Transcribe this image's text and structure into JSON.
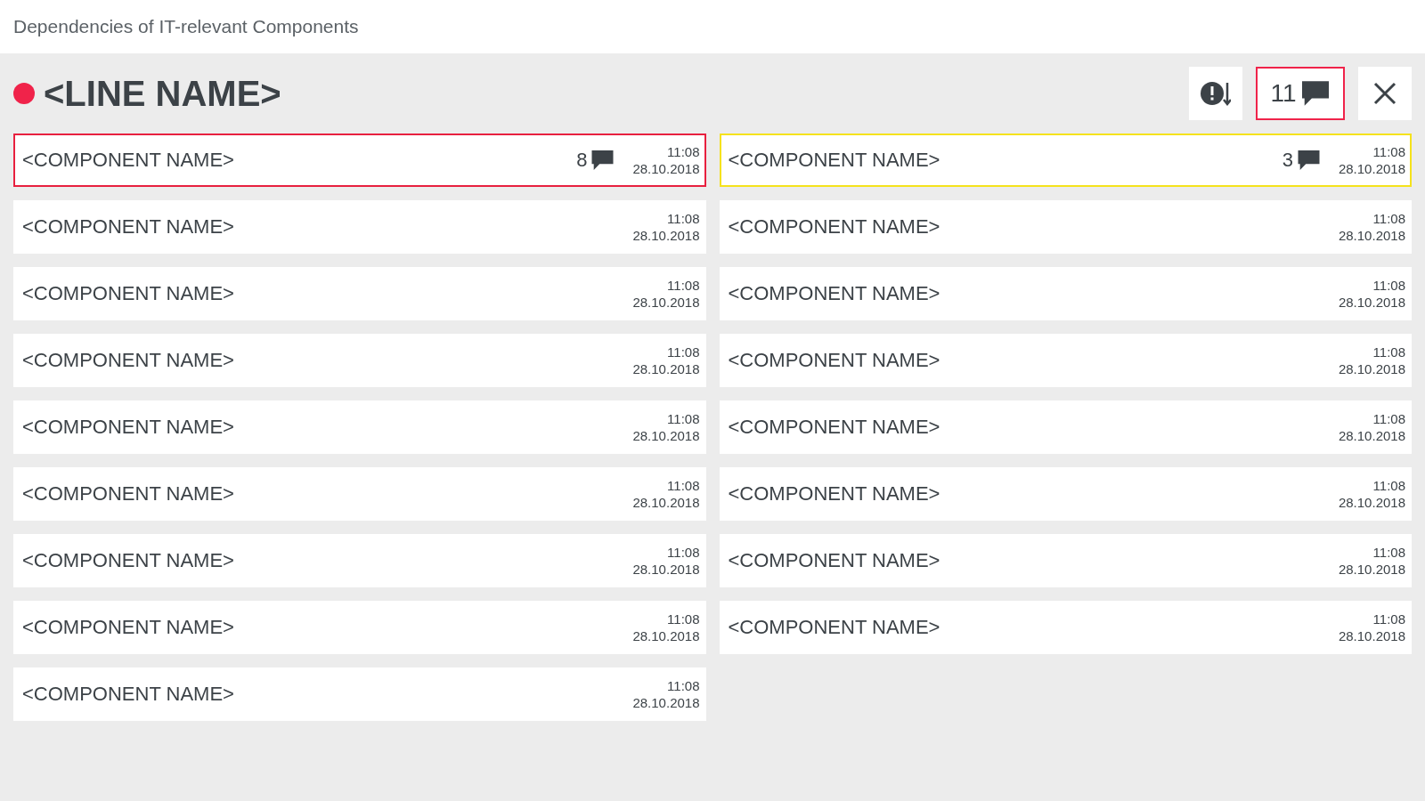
{
  "window": {
    "title": "Dependencies of IT-relevant Components"
  },
  "line": {
    "name": "<LINE NAME>",
    "color": "#f0234a"
  },
  "toolbar": {
    "comments": {
      "count": "11",
      "color": "#f0234a"
    }
  },
  "components": [
    {
      "name": "<COMPONENT NAME>",
      "comments": "8",
      "time": "11:08",
      "date": "28.10.2018",
      "color": "#e8203f"
    },
    {
      "name": "<COMPONENT NAME>",
      "comments": "3",
      "time": "11:08",
      "date": "28.10.2018",
      "color": "#f5e21c"
    },
    {
      "name": "<COMPONENT NAME>",
      "time": "11:08",
      "date": "28.10.2018"
    },
    {
      "name": "<COMPONENT NAME>",
      "time": "11:08",
      "date": "28.10.2018"
    },
    {
      "name": "<COMPONENT NAME>",
      "time": "11:08",
      "date": "28.10.2018"
    },
    {
      "name": "<COMPONENT NAME>",
      "time": "11:08",
      "date": "28.10.2018"
    },
    {
      "name": "<COMPONENT NAME>",
      "time": "11:08",
      "date": "28.10.2018"
    },
    {
      "name": "<COMPONENT NAME>",
      "time": "11:08",
      "date": "28.10.2018"
    },
    {
      "name": "<COMPONENT NAME>",
      "time": "11:08",
      "date": "28.10.2018"
    },
    {
      "name": "<COMPONENT NAME>",
      "time": "11:08",
      "date": "28.10.2018"
    },
    {
      "name": "<COMPONENT NAME>",
      "time": "11:08",
      "date": "28.10.2018"
    },
    {
      "name": "<COMPONENT NAME>",
      "time": "11:08",
      "date": "28.10.2018"
    },
    {
      "name": "<COMPONENT NAME>",
      "time": "11:08",
      "date": "28.10.2018"
    },
    {
      "name": "<COMPONENT NAME>",
      "time": "11:08",
      "date": "28.10.2018"
    },
    {
      "name": "<COMPONENT NAME>",
      "time": "11:08",
      "date": "28.10.2018"
    },
    {
      "name": "<COMPONENT NAME>",
      "time": "11:08",
      "date": "28.10.2018"
    },
    {
      "name": "<COMPONENT NAME>",
      "time": "11:08",
      "date": "28.10.2018"
    }
  ]
}
